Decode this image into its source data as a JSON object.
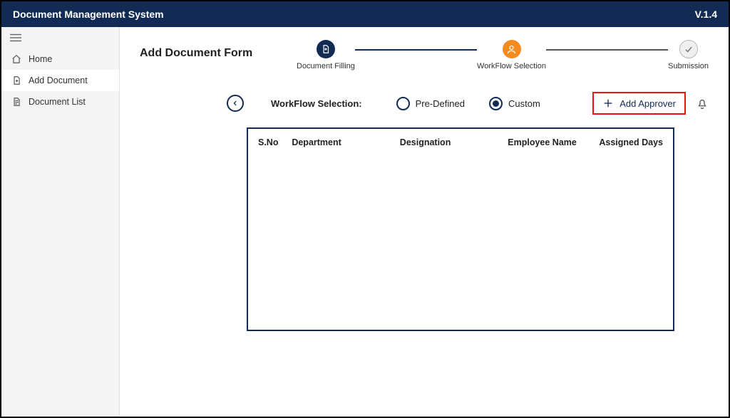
{
  "header": {
    "title": "Document Management System",
    "version": "V.1.4"
  },
  "sidebar": {
    "items": [
      {
        "label": "Home",
        "icon": "home"
      },
      {
        "label": "Add Document",
        "icon": "doc-plus"
      },
      {
        "label": "Document List",
        "icon": "doc-list"
      }
    ]
  },
  "main": {
    "title": "Add Document Form",
    "stepper": {
      "steps": [
        {
          "label": "Document Filling",
          "state": "done"
        },
        {
          "label": "WorkFlow Selection",
          "state": "active"
        },
        {
          "label": "Submission",
          "state": "pending"
        }
      ]
    },
    "workflow": {
      "label": "WorkFlow Selection:",
      "options": [
        {
          "label": "Pre-Defined",
          "selected": false
        },
        {
          "label": "Custom",
          "selected": true
        }
      ]
    },
    "add_approver_label": "Add Approver",
    "table": {
      "columns": [
        "S.No",
        "Department",
        "Designation",
        "Employee Name",
        "Assigned Days"
      ],
      "rows": []
    }
  }
}
